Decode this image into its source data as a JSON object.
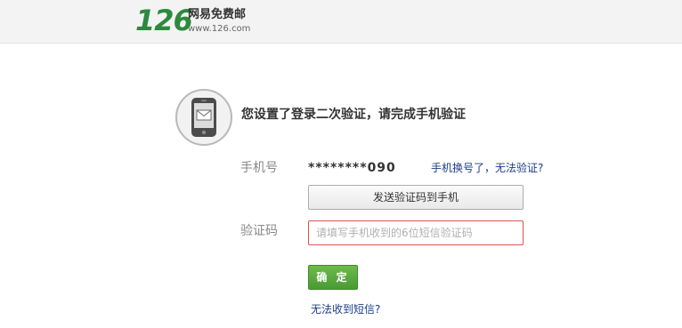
{
  "header": {
    "logo_number": "126",
    "logo_name": "网易免费邮",
    "logo_url": "www.126.com"
  },
  "verify": {
    "headline": "您设置了登录二次验证，请完成手机验证",
    "phone_label": "手机号",
    "masked_phone": "********090",
    "change_phone_link": "手机换号了，无法验证?",
    "send_code_button": "发送验证码到手机",
    "code_label": "验证码",
    "code_placeholder": "请填写手机收到的6位短信验证码",
    "code_value": "",
    "confirm_button": "确 定",
    "no_sms_link": "无法收到短信?"
  },
  "icons": {
    "phone": "phone-message-icon"
  },
  "colors": {
    "brand_green": "#2c8a3d",
    "link_blue": "#1a3c8a",
    "error_red": "#d9534f",
    "confirm_green": "#5aaa3e"
  }
}
